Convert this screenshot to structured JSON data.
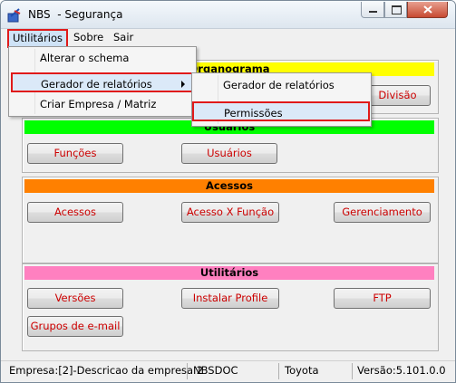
{
  "window": {
    "title": "NBS  - Segurança"
  },
  "menubar": {
    "items": [
      "Utilitários",
      "Sobre",
      "Sair"
    ]
  },
  "dropdown": {
    "items": [
      "Alterar o schema",
      "Gerador de relatórios",
      "Criar Empresa / Matriz"
    ]
  },
  "submenu": {
    "items": [
      "Gerador de relatórios",
      "Permissões"
    ]
  },
  "sections": {
    "organograma": {
      "title": "Organograma",
      "color": "#ffff00",
      "visible_button": "Divisão"
    },
    "usuarios": {
      "title": "Usuários",
      "color": "#00ff00",
      "buttons": [
        "Funções",
        "Usuários"
      ]
    },
    "acessos": {
      "title": "Acessos",
      "color": "#ff8000",
      "buttons": [
        "Acessos",
        "Acesso X Função",
        "Gerenciamento"
      ]
    },
    "utilitarios": {
      "title": "Utilitários",
      "color": "#ff80c0",
      "buttons": [
        "Versões",
        "Instalar Profile",
        "FTP",
        "Grupos de e-mail"
      ]
    }
  },
  "statusbar": {
    "empresa": "Empresa:[2]-Descricao da empresa 2",
    "db": "NBSDOC",
    "user": "Toyota",
    "version": "Versão:5.101.0.0"
  },
  "colors": {
    "highlight_border": "#e01a1a",
    "button_text": "#cc0000"
  }
}
